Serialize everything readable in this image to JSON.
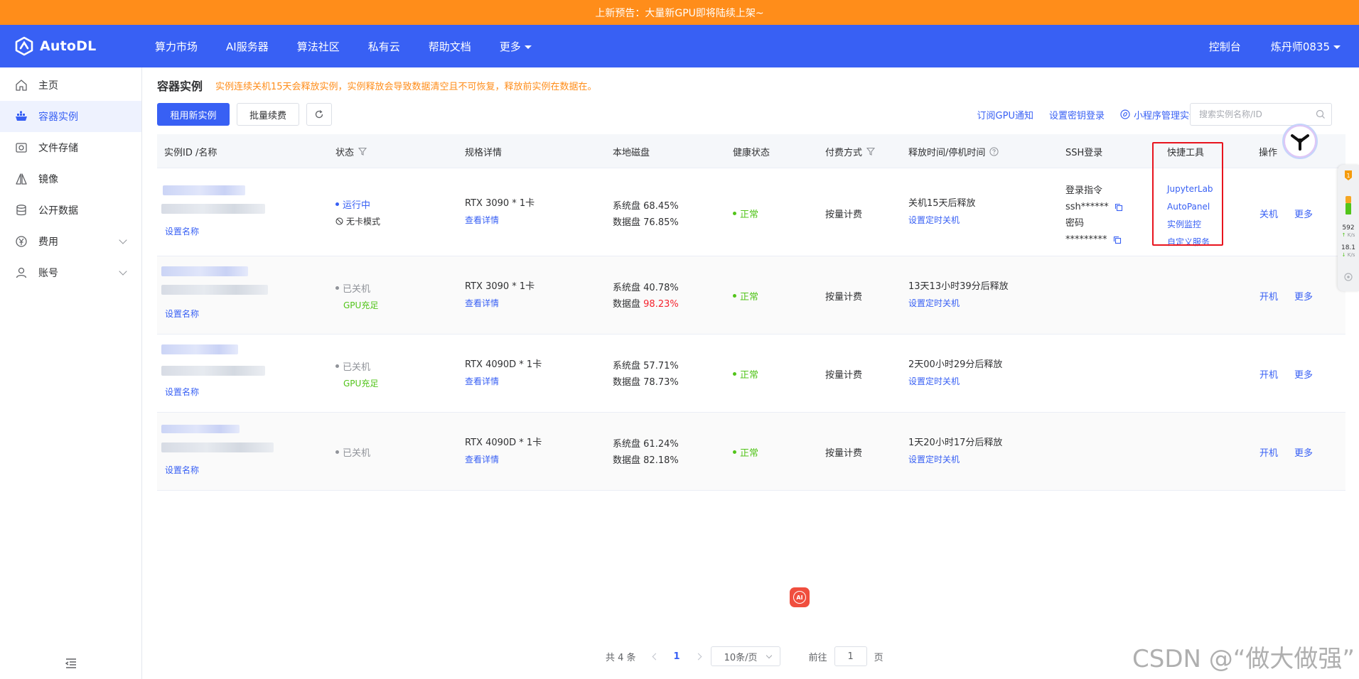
{
  "banner": {
    "text": "上新预告：大量新GPU即将陆续上架~"
  },
  "navbar": {
    "logo": "AutoDL",
    "items": [
      "算力市场",
      "AI服务器",
      "算法社区",
      "私有云",
      "帮助文档",
      "更多"
    ],
    "console": "控制台",
    "user": "炼丹师0835"
  },
  "sidebar": {
    "items": [
      {
        "label": "主页",
        "icon": "home-icon"
      },
      {
        "label": "容器实例",
        "icon": "container-icon"
      },
      {
        "label": "文件存储",
        "icon": "storage-icon"
      },
      {
        "label": "镜像",
        "icon": "image-icon"
      },
      {
        "label": "公开数据",
        "icon": "database-icon"
      },
      {
        "label": "费用",
        "icon": "yen-icon"
      },
      {
        "label": "账号",
        "icon": "user-icon"
      }
    ]
  },
  "page": {
    "title": "容器实例",
    "warning": "实例连续关机15天会释放实例，实例释放会导致数据清空且不可恢复，释放前实例在数据在。"
  },
  "toolbar": {
    "rent": "租用新实例",
    "renew": "批量续费",
    "links": [
      "订阅GPU通知",
      "设置密钥登录",
      "小程序管理实例"
    ],
    "search_placeholder": "搜索实例名称/ID"
  },
  "table": {
    "headers": [
      "实例ID /名称",
      "状态",
      "规格详情",
      "本地磁盘",
      "健康状态",
      "付费方式",
      "释放时间/停机时间",
      "SSH登录",
      "快捷工具",
      "操作"
    ],
    "rename": "设置名称",
    "view_detail": "查看详情",
    "set_shutdown": "设置定时关机",
    "sys_disk": "系统盘",
    "data_disk": "数据盘",
    "billing": "按量计费",
    "healthy": "正常",
    "more": "更多",
    "ssh": {
      "cmd_label": "登录指令",
      "cmd_value": "ssh******",
      "pwd_label": "密码",
      "pwd_value": "*********"
    },
    "tools": [
      "JupyterLab",
      "AutoPanel",
      "实例监控",
      "自定义服务"
    ],
    "rows": [
      {
        "status": "运行中",
        "sub": "无卡模式",
        "spec": "RTX 3090 * 1卡",
        "sys": "68.45%",
        "data": "76.85%",
        "release": "关机15天后释放",
        "action": "关机"
      },
      {
        "status": "已关机",
        "sub": "GPU充足",
        "spec": "RTX 3090 * 1卡",
        "sys": "40.78%",
        "data": "98.23%",
        "release": "13天13小时39分后释放",
        "action": "开机"
      },
      {
        "status": "已关机",
        "sub": "GPU充足",
        "spec": "RTX 4090D * 1卡",
        "sys": "57.71%",
        "data": "78.73%",
        "release": "2天00小时29分后释放",
        "action": "开机"
      },
      {
        "status": "已关机",
        "sub": "",
        "spec": "RTX 4090D * 1卡",
        "sys": "61.24%",
        "data": "82.18%",
        "release": "1天20小时17分后释放",
        "action": "开机"
      }
    ]
  },
  "pagination": {
    "total": "共 4 条",
    "current": "1",
    "page_size": "10条/页",
    "goto_label": "前往",
    "goto_value": "1",
    "page_suffix": "页"
  },
  "widget": {
    "up": "592",
    "down": "18.1",
    "unit": "K/s"
  },
  "ai_badge": "AI",
  "watermark": "CSDN @“做大做强”",
  "colors": {
    "primary": "#3860f4",
    "banner": "#ff8d1a",
    "success": "#52c41a",
    "danger": "#f5222d",
    "highlight": "#e8141e"
  }
}
